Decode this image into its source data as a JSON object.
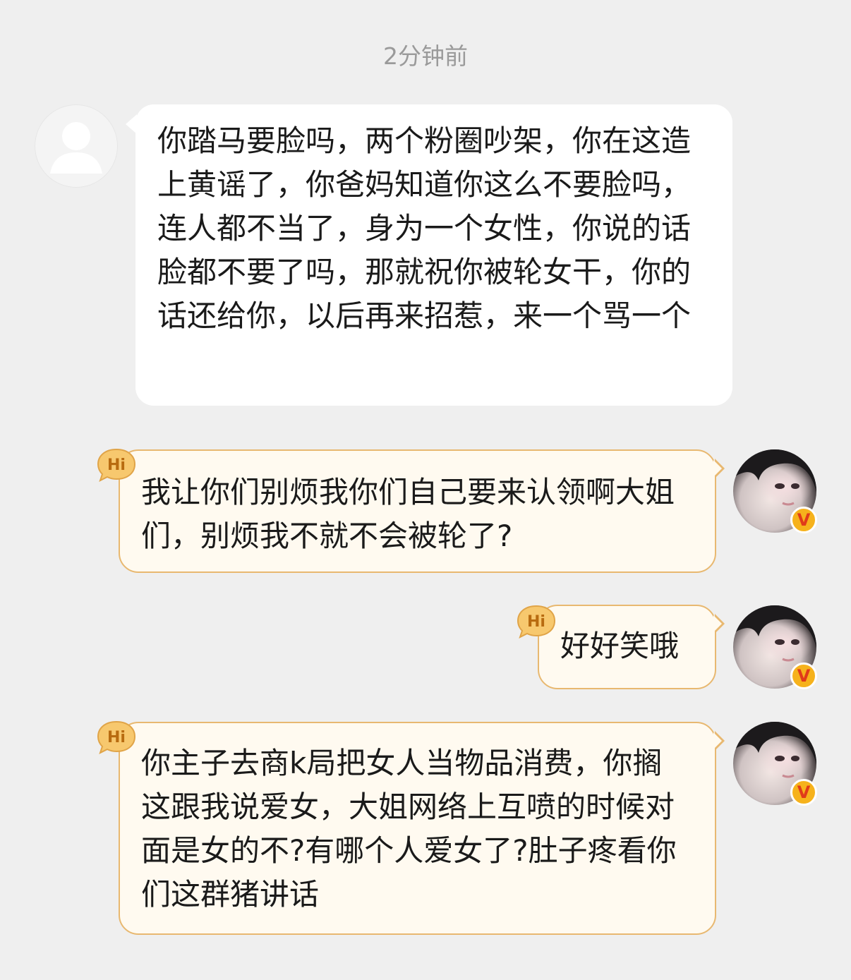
{
  "timestamp": "2分钟前",
  "messages": [
    {
      "side": "incoming",
      "text": "你踏马要脸吗，两个粉圈吵架，你在这造上黄谣了，你爸妈知道你这么不要脸吗，连人都不当了，身为一个女性，你说的话脸都不要了吗，那就祝你被轮女干，你的话还给你，以后再来招惹，来一个骂一个"
    },
    {
      "side": "outgoing",
      "badge": "Hi",
      "text": "我让你们别烦我你们自己要来认领啊大姐们，别烦我不就不会被轮了?"
    },
    {
      "side": "outgoing",
      "badge": "Hi",
      "text": "好好笑哦"
    },
    {
      "side": "outgoing",
      "badge": "Hi",
      "text": "你主子去商k局把女人当物品消费，你搁这跟我说爱女，大姐网络上互喷的时候对面是女的不?有哪个人爱女了?肚子疼看你们这群猪讲话"
    }
  ],
  "verified_badge": "V",
  "icons": {
    "incoming_avatar": "default-avatar-icon",
    "outgoing_avatar": "user-avatar",
    "badge": "hi-badge-icon",
    "verified": "verified-v-icon"
  },
  "colors": {
    "background": "#efefef",
    "incoming_bubble": "#ffffff",
    "outgoing_bubble": "#fffaf0",
    "outgoing_border": "#e8b870",
    "hi_badge": "#f7c86e",
    "verified_badge": "#f6b21c"
  }
}
